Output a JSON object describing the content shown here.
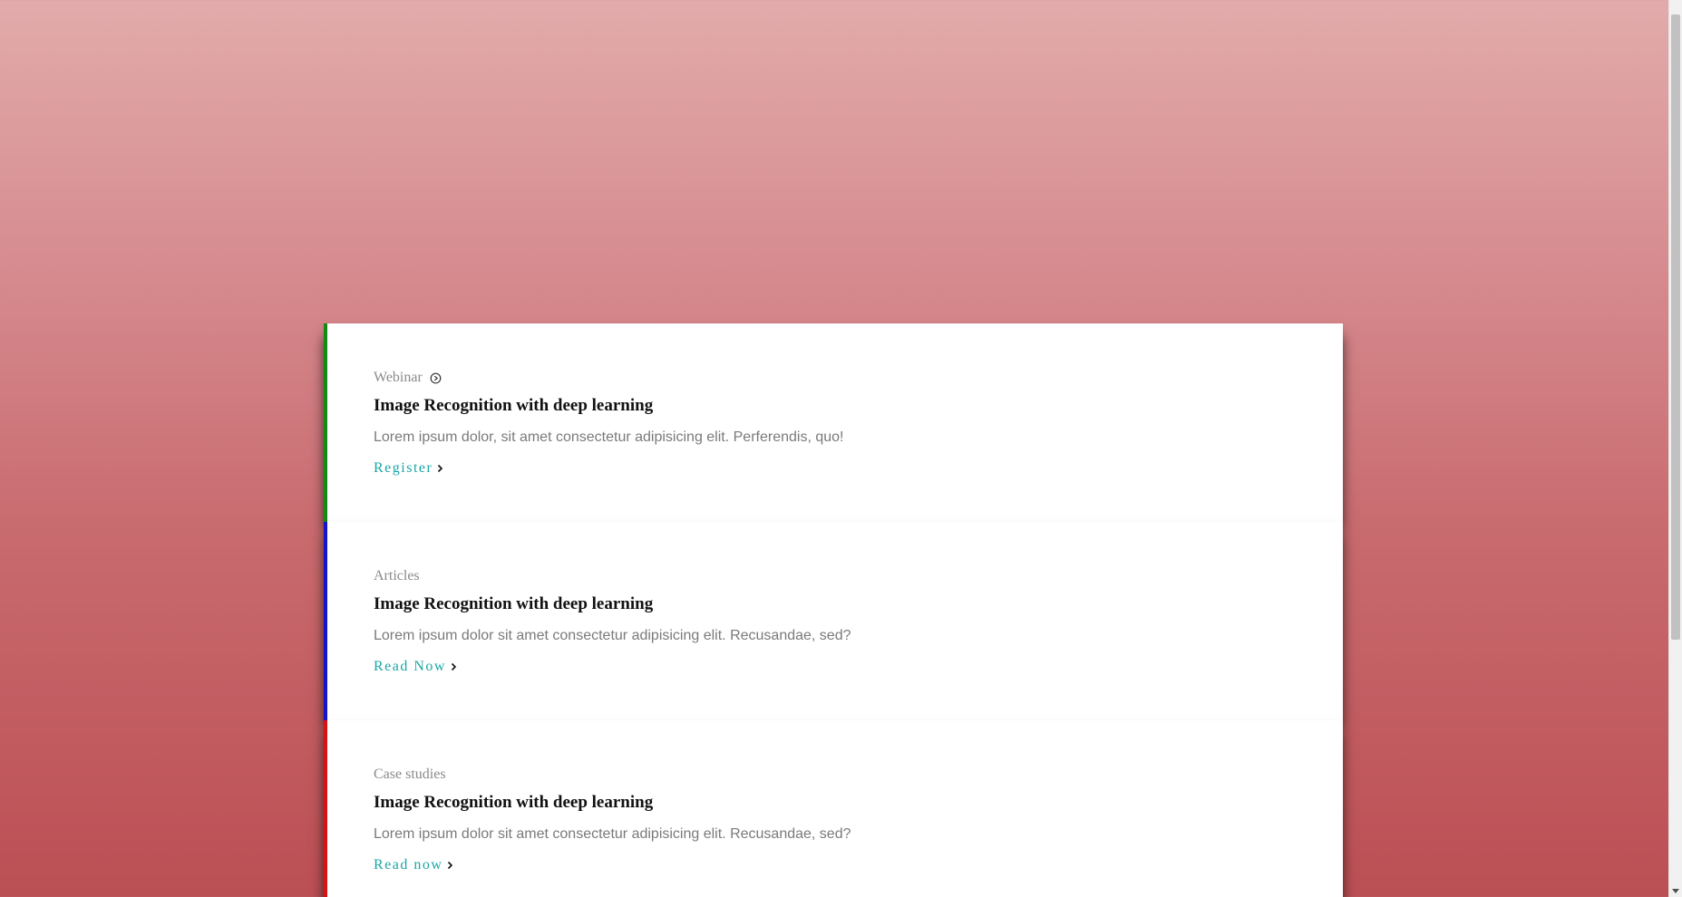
{
  "cards": [
    {
      "category": "Webinar",
      "category_icon": "play-circle-icon",
      "accent_color": "#138a13",
      "title": "Image Recognition with deep learning",
      "description": "Lorem ipsum dolor, sit amet consectetur adipisicing elit. Perferendis, quo!",
      "link_label": "Register"
    },
    {
      "category": "Articles",
      "accent_color": "#1414c8",
      "title": "Image Recognition with deep learning",
      "description": "Lorem ipsum dolor sit amet consectetur adipisicing elit. Recusandae, sed?",
      "link_label": "Read Now"
    },
    {
      "category": "Case studies",
      "accent_color": "#d41414",
      "title": "Image Recognition with deep learning",
      "description": "Lorem ipsum dolor sit amet consectetur adipisicing elit. Recusandae, sed?",
      "link_label": "Read now"
    }
  ],
  "colors": {
    "link": "#1aa6a6",
    "background_top": "#e2abab",
    "background_bottom": "#bb4f54"
  }
}
